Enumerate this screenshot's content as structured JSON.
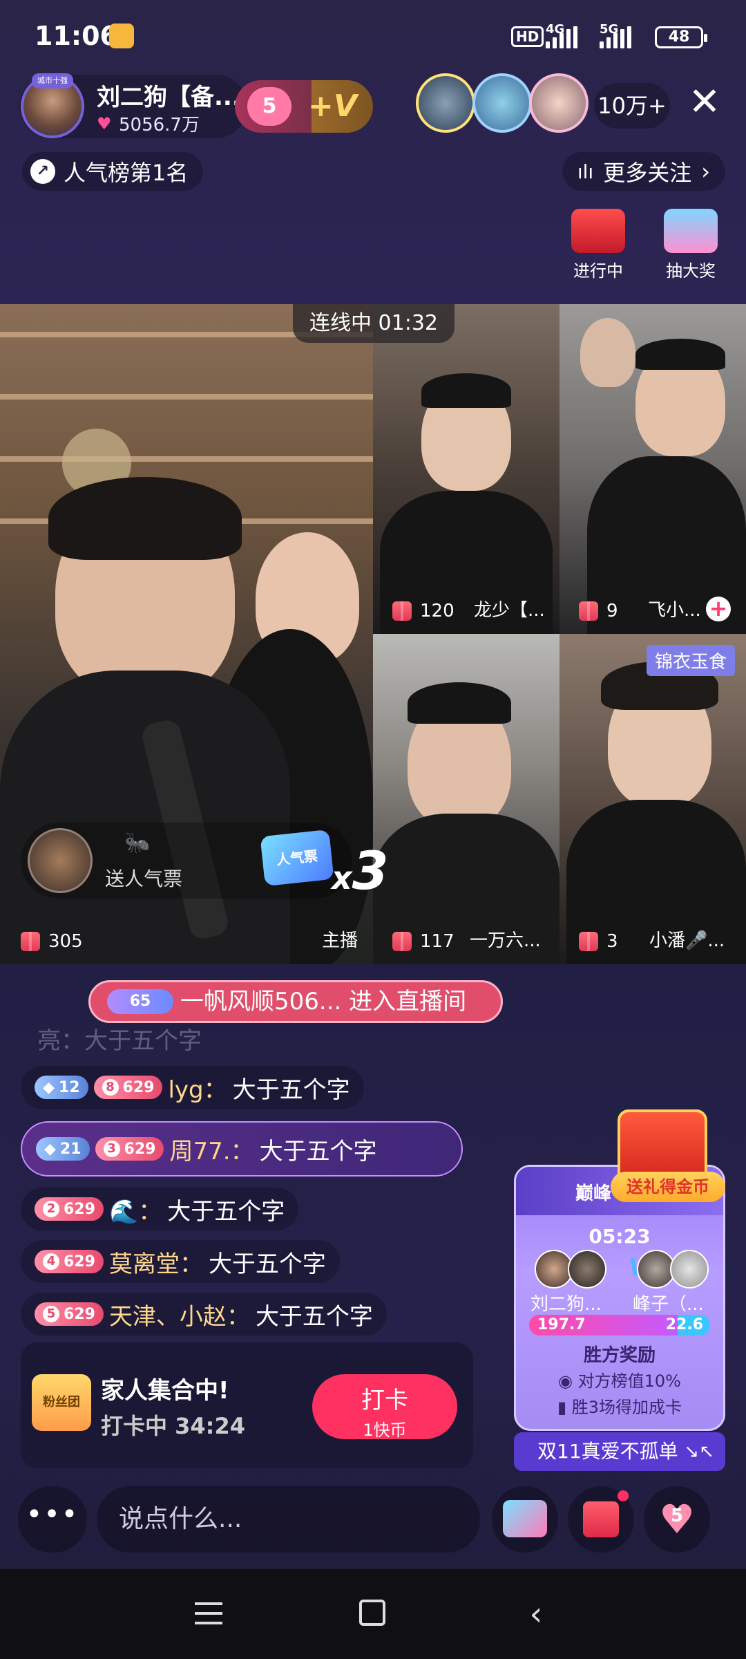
{
  "status_bar": {
    "time": "11:06",
    "network_1": "4G",
    "network_2": "5G",
    "hd": "HD",
    "battery": "48"
  },
  "header": {
    "host_name": "刘二狗【备...",
    "host_likes": "5056.7万",
    "host_badge": "城市十强",
    "fan_level": "5",
    "plus_v": "+V",
    "viewer_count": "10万+",
    "rank_text": "人气榜第1名",
    "more_follow": "更多关注"
  },
  "activities": {
    "ongoing": "进行中",
    "lottery": "抽大奖"
  },
  "live": {
    "connect_label": "连线中",
    "connect_time": "01:32",
    "main_gift": "305",
    "main_label": "主播",
    "vote_text": "送人气票",
    "ticket_label": "人气票",
    "multiplier": "3",
    "guests": [
      {
        "gift": "120",
        "name": "龙少【..."
      },
      {
        "gift": "9",
        "name": "飞小..."
      },
      {
        "gift": "117",
        "name": "一万六..."
      },
      {
        "gift": "3",
        "name": "小潘🎤..."
      }
    ],
    "guest_tag": "锦衣玉食"
  },
  "chat": {
    "enter_badge": "65",
    "enter_text": "一帆风顺506... 进入直播间",
    "faded_line": "亮：大于五个字",
    "messages": [
      {
        "badge1": "12",
        "badge2_num": "8",
        "badge2": "629",
        "user": "lyg：",
        "text": "大于五个字"
      },
      {
        "badge1": "21",
        "badge2_num": "3",
        "badge2": "629",
        "user": "周77.：",
        "text": "大于五个字"
      },
      {
        "badge2_num": "2",
        "badge2": "629",
        "user": "🌊：",
        "text": "大于五个字"
      },
      {
        "badge2_num": "4",
        "badge2": "629",
        "user": "莫离堂：",
        "text": "大于五个字"
      },
      {
        "badge2_num": "5",
        "badge2": "629",
        "user": "天津、小赵：",
        "text": "大于五个字"
      }
    ]
  },
  "checkin": {
    "logo": "粉丝团",
    "title": "家人集合中!",
    "subtitle": "打卡中 34:24",
    "button": "打卡",
    "button_sub": "1快币"
  },
  "pk": {
    "head": "巅峰",
    "gold": "送礼得金币",
    "time": "05:23",
    "vs": "VS",
    "left_name": "刘二狗...",
    "right_name": "峰子（...",
    "left_score": "197.7",
    "right_score": "22.6",
    "reward": "胜方奖励",
    "line1": "对方榜值10%",
    "line2": "胜3场得加成卡",
    "bottom": "双11真爱不孤单"
  },
  "input": {
    "more": "•••",
    "placeholder": "说点什么...",
    "heart_count": "5"
  },
  "colors": {
    "accent": "#ff3160",
    "pk_purple": "#9a7cf5",
    "background": "#1f1c3b"
  }
}
